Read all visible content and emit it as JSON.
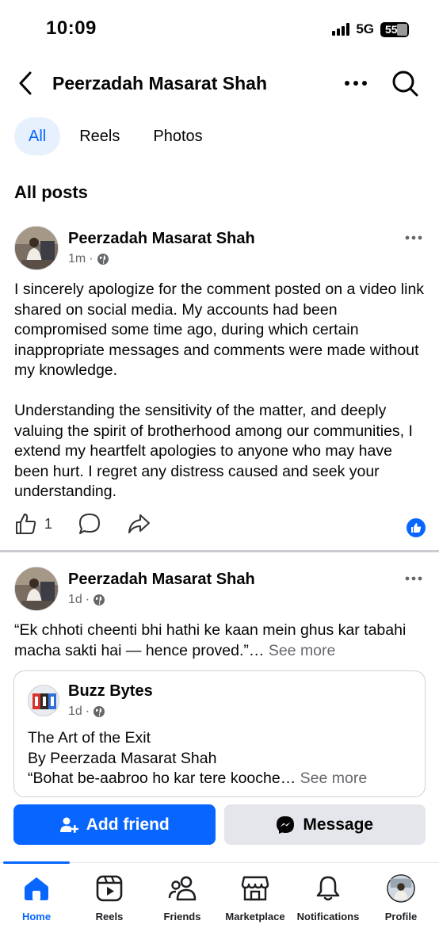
{
  "status_bar": {
    "time": "10:09",
    "network": "5G",
    "battery": "55"
  },
  "header": {
    "title": "Peerzadah Masarat Shah"
  },
  "filter_tabs": [
    {
      "label": "All",
      "active": true
    },
    {
      "label": "Reels",
      "active": false
    },
    {
      "label": "Photos",
      "active": false
    }
  ],
  "section_title": "All posts",
  "posts": [
    {
      "author": "Peerzadah Masarat Shah",
      "time": "1m",
      "paragraphs": [
        "I sincerely apologize for the comment posted on a video link shared on social media. My accounts had been compromised some time ago, during which certain inappropriate messages and comments were made without my knowledge.",
        "Understanding the sensitivity of the matter, and deeply valuing the spirit of brotherhood among our communities, I extend my heartfelt apologies to anyone who may have been hurt. I regret any distress caused and seek your understanding."
      ],
      "like_count": "1"
    },
    {
      "author": "Peerzadah Masarat Shah",
      "time": "1d",
      "text": "“Ek chhoti cheenti bhi hathi ke kaan mein ghus kar tabahi macha sakti hai — hence proved.”…",
      "see_more": "See more",
      "shared": {
        "author": "Buzz Bytes",
        "time": "1d",
        "line1": "The Art of the Exit",
        "line2": "By Peerzada Masarat Shah",
        "line3": "“Bohat be-aabroo ho kar tere kooche…",
        "see_more": "See more"
      }
    }
  ],
  "cta": {
    "add_friend": "Add friend",
    "message": "Message"
  },
  "bottom_nav": [
    {
      "label": "Home",
      "icon": "home-icon",
      "active": true
    },
    {
      "label": "Reels",
      "icon": "reels-icon",
      "active": false
    },
    {
      "label": "Friends",
      "icon": "friends-icon",
      "active": false
    },
    {
      "label": "Marketplace",
      "icon": "marketplace-icon",
      "active": false
    },
    {
      "label": "Notifications",
      "icon": "bell-icon",
      "active": false
    },
    {
      "label": "Profile",
      "icon": "profile-avatar",
      "active": false
    }
  ],
  "colors": {
    "brand": "#0866ff",
    "text": "#050505",
    "muted": "#65676b",
    "divider": "#c9ccd1"
  }
}
